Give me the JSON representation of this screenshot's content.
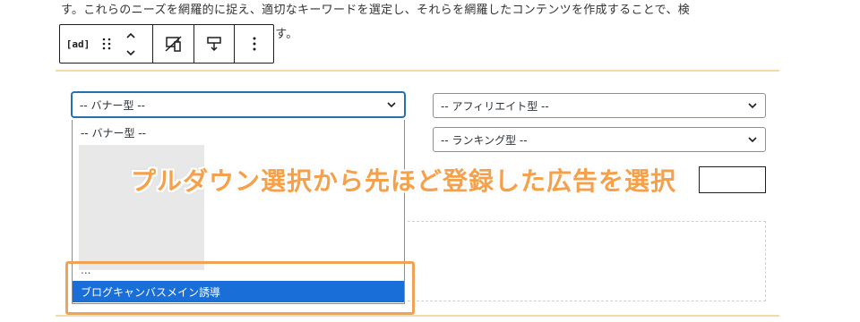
{
  "paragraph": {
    "line1": "す。これらのニーズを網羅的に捉え、適切なキーワードを選定し、それらを網羅したコンテンツを作成することで、検",
    "line2": "できるのです。"
  },
  "toolbar": {
    "ad_label": "[ad]",
    "icons": [
      "drag-handle-icon",
      "chevron-up-icon",
      "chevron-down-icon",
      "devices-icon",
      "align-icon",
      "more-options-icon"
    ]
  },
  "ad_settings": {
    "banner_select": {
      "value": "-- バナー型 --"
    },
    "affiliate_select": {
      "value": "-- アフィリエイト型 --"
    },
    "ranking_select": {
      "value": "-- ランキング型 --"
    }
  },
  "dropdown": {
    "options": [
      "-- バナー型 --",
      "...",
      "ブログキャンバスメイン誘導"
    ],
    "selected_index": 2
  },
  "annotation": {
    "text": "プルダウン選択から先ほど登録した広告を選択",
    "color": "#f5a04a"
  },
  "colors": {
    "accent": "#2271b1",
    "selection": "#1a6ed8",
    "highlight": "#f0a257"
  }
}
